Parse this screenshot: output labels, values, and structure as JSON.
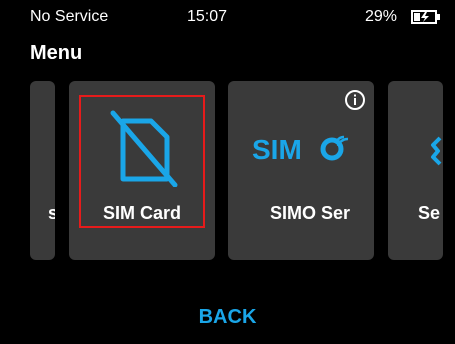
{
  "status_bar": {
    "carrier": "No Service",
    "time": "15:07",
    "battery": "29%"
  },
  "title": "Menu",
  "cards": {
    "left_partial_label": "s",
    "sim_label": "SIM Card",
    "simo_label": "SIMO Ser",
    "right_partial_label": "Se"
  },
  "simo_logo_text": "SIM",
  "back_label": "BACK",
  "colors": {
    "accent": "#1aa6e8",
    "highlight": "#e61b1b",
    "card_bg": "#3a3a3a"
  },
  "icons": [
    "battery-charging-icon",
    "sim-card-off-icon",
    "simo-logo",
    "info-icon"
  ]
}
